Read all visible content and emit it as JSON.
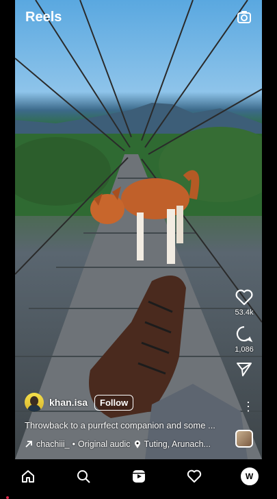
{
  "header": {
    "title": "Reels",
    "camera_icon": "camera-icon"
  },
  "actions": {
    "likes": "53.4k",
    "comments": "1,086"
  },
  "post": {
    "username": "khan.isa",
    "follow_label": "Follow",
    "caption": "Throwback to a purrfect companion and some ...",
    "tagged": "chachiii_",
    "audio": "Original audic",
    "location": "Tuting, Arunach..."
  },
  "nav": {
    "items": [
      "home-icon",
      "search-icon",
      "reels-icon",
      "heart-icon",
      "profile-avatar"
    ],
    "profile_initial": "W"
  },
  "colors": {
    "notification_dot": "#e3294b",
    "background": "#000000"
  }
}
